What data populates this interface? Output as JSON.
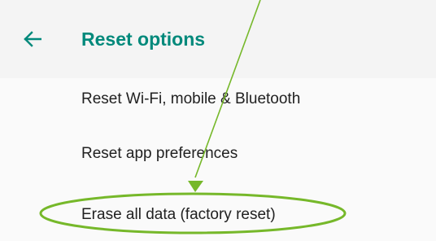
{
  "header": {
    "back_icon": "arrow-left-icon",
    "title": "Reset options",
    "accent_color": "#00897b"
  },
  "menu": {
    "items": [
      {
        "label": "Reset Wi-Fi, mobile & Bluetooth"
      },
      {
        "label": "Reset app preferences"
      },
      {
        "label": "Erase all data (factory reset)"
      }
    ]
  },
  "annotation": {
    "color": "#76b82a",
    "arrow_icon": "green-arrow-icon",
    "highlight": "green-ellipse-highlight"
  }
}
